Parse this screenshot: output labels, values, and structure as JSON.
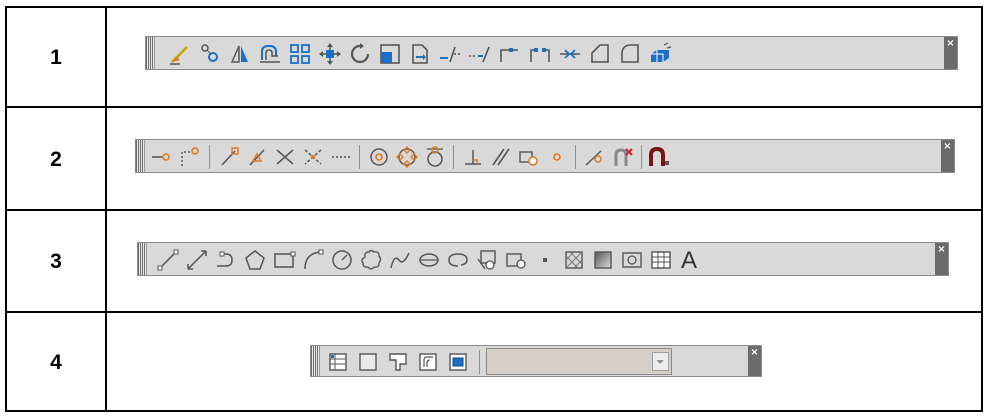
{
  "rows": [
    {
      "number": "1",
      "toolbar": "modify"
    },
    {
      "number": "2",
      "toolbar": "object-snap"
    },
    {
      "number": "3",
      "toolbar": "draw"
    },
    {
      "number": "4",
      "toolbar": "layers"
    }
  ],
  "close_glyph": "×",
  "layers": {
    "combo_value": ""
  },
  "colors": {
    "icon_blue": "#1b6fc7",
    "icon_orange": "#e07a20",
    "toolbar_bg": "#d9d9d9"
  }
}
